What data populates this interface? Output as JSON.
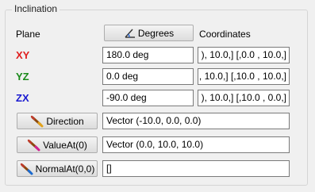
{
  "panel": {
    "title": "Inclination"
  },
  "header": {
    "plane_label": "Plane",
    "degrees_button": "Degrees",
    "coordinates_label": "Coordinates"
  },
  "rows": [
    {
      "axis": "XY",
      "axis_color": "#e02020",
      "value": "180.0 deg",
      "coordinates": "), 10.0,] [,0.0 , 10.0,]"
    },
    {
      "axis": "YZ",
      "axis_color": "#1a8a1a",
      "value": "0.0 deg",
      "coordinates": ", 10.0,] [,10.0 , 10.0,]"
    },
    {
      "axis": "ZX",
      "axis_color": "#1a1ad0",
      "value": "-90.0 deg",
      "coordinates": "), 10.0,] [,10.0 , 0.0,]"
    }
  ],
  "commands": [
    {
      "label": "Direction",
      "value": "Vector (-10.0, 0.0, 0.0)"
    },
    {
      "label": "ValueAt(0)",
      "value": "Vector (0.0, 10.0, 10.0)"
    },
    {
      "label": "NormalAt(0,0)",
      "value": "[]"
    }
  ]
}
